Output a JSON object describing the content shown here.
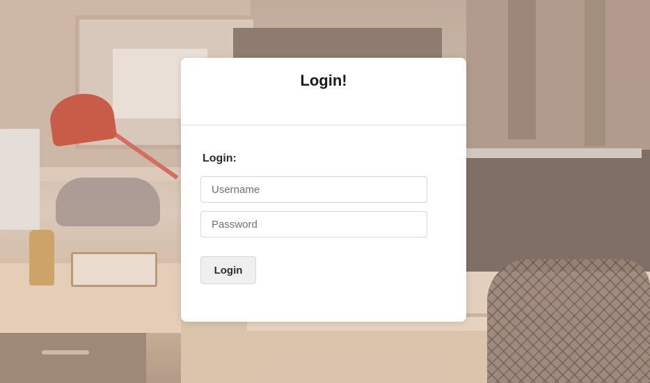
{
  "modal": {
    "title": "Login!",
    "form_label": "Login:",
    "username_placeholder": "Username",
    "password_placeholder": "Password",
    "submit_label": "Login"
  },
  "colors": {
    "modal_background": "#ffffff",
    "button_background": "#efefef",
    "title_text": "#1a1a1a"
  }
}
